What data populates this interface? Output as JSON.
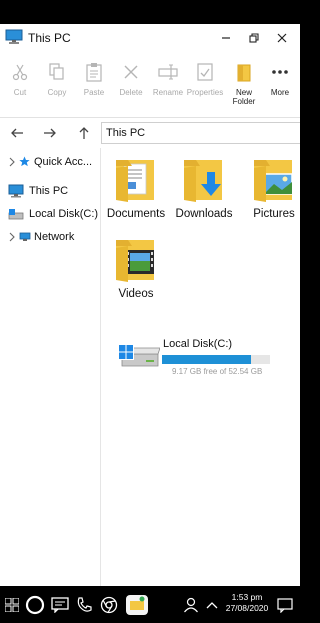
{
  "window": {
    "title": "This PC"
  },
  "ribbon": {
    "cut": "Cut",
    "copy": "Copy",
    "paste": "Paste",
    "delete": "Delete",
    "rename": "Rename",
    "properties": "Properties",
    "new_folder": "New Folder",
    "more": "More"
  },
  "address": {
    "path": "This PC"
  },
  "sidebar": {
    "quick_access": "Quick Acc...",
    "this_pc": "This PC",
    "local_disk": "Local Disk(C:)",
    "network": "Network"
  },
  "folders": [
    {
      "name": "Documents",
      "icon": "documents-folder-icon"
    },
    {
      "name": "Downloads",
      "icon": "downloads-folder-icon"
    },
    {
      "name": "Pictures",
      "icon": "pictures-folder-icon"
    },
    {
      "name": "Videos",
      "icon": "videos-folder-icon"
    }
  ],
  "drive": {
    "name": "Local Disk(C:)",
    "free_text": "9.17 GB free of 52.54 GB",
    "used_fraction": 0.825,
    "bar_color": "#1e90d6"
  },
  "taskbar": {
    "time": "1:53 pm",
    "date": "27/08/2020"
  }
}
